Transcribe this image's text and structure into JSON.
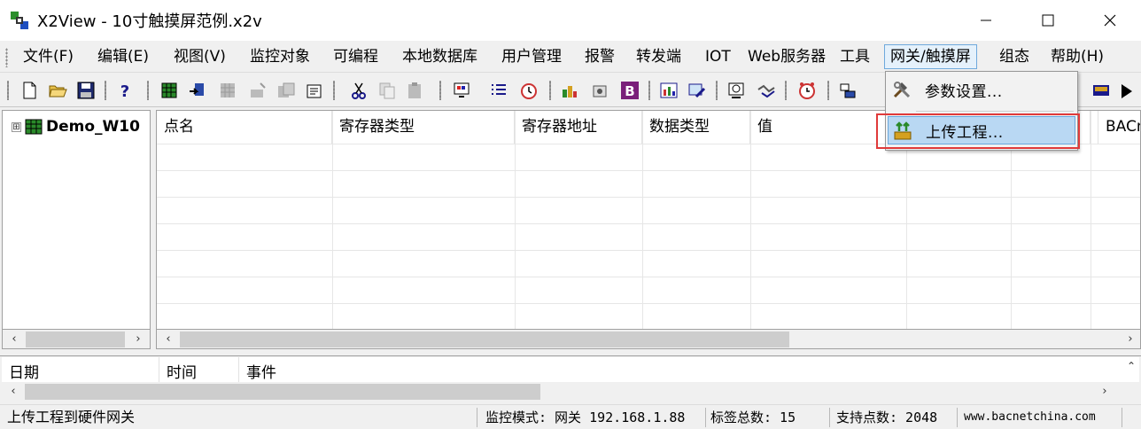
{
  "window": {
    "title": "X2View - 10寸触摸屏范例.x2v",
    "controls": {
      "minimize": "minimize",
      "maximize": "maximize",
      "close": "close"
    }
  },
  "menubar": {
    "items": [
      {
        "label": "文件(F)"
      },
      {
        "label": "编辑(E)"
      },
      {
        "label": "视图(V)"
      },
      {
        "label": "监控对象"
      },
      {
        "label": "可编程"
      },
      {
        "label": "本地数据库"
      },
      {
        "label": "用户管理"
      },
      {
        "label": "报警"
      },
      {
        "label": "转发端"
      },
      {
        "label": "IOT"
      },
      {
        "label": "Web服务器"
      },
      {
        "label": "工具"
      },
      {
        "label": "网关/触摸屏",
        "active": true
      },
      {
        "label": "组态"
      },
      {
        "label": "帮助(H)"
      }
    ]
  },
  "toolbar": {
    "icons": [
      "new-file-icon",
      "open-folder-icon",
      "save-icon",
      "help-icon",
      "grid-icon",
      "import-icon",
      "table-icon",
      "wizard-icon",
      "copy-device-icon",
      "properties-icon",
      "cut-icon",
      "copy-icon",
      "paste-icon",
      "monitor-icon",
      "list-icon",
      "clock-icon",
      "download-icon",
      "program-icon",
      "bold-b-icon",
      "chart-icon",
      "edit-icon",
      "report-icon",
      "handshake-icon",
      "alarm-clock-icon",
      "gateway-icon"
    ]
  },
  "tree": {
    "root_label": "Demo_W10",
    "expander": "⊞"
  },
  "grid": {
    "columns": [
      "点名",
      "寄存器类型",
      "寄存器地址",
      "数据类型",
      "值",
      "",
      "",
      "",
      "BACn"
    ]
  },
  "log": {
    "columns": [
      "日期",
      "时间",
      "事件"
    ]
  },
  "dropdown": {
    "items": [
      {
        "label": "参数设置...",
        "icon": "hammer-wrench-icon"
      },
      {
        "label": "上传工程...",
        "icon": "upload-project-icon",
        "highlighted": true
      }
    ]
  },
  "statusbar": {
    "message": "上传工程到硬件网关",
    "mode": "监控模式: 网关 192.168.1.88",
    "tag_count": "标签总数: 15",
    "support_points": "支持点数: 2048",
    "website": "www.bacnetchina.com"
  }
}
